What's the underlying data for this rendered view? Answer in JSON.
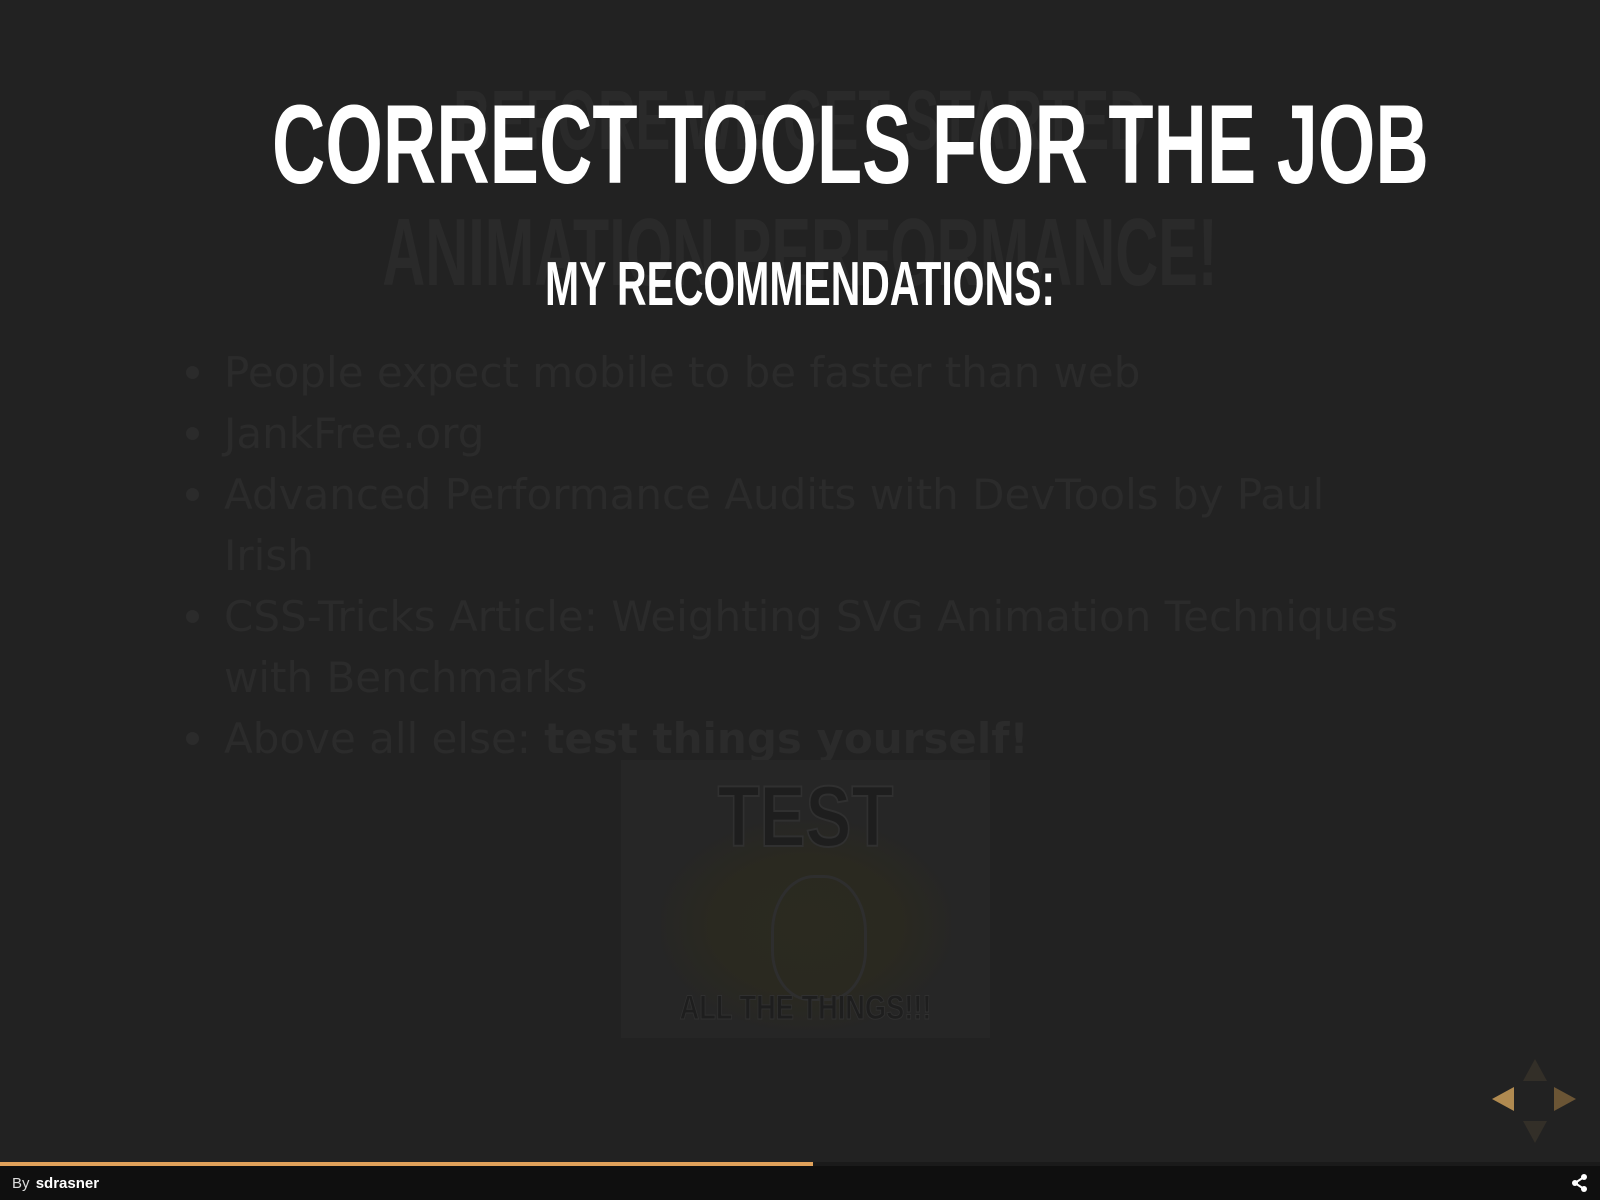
{
  "slide": {
    "title": "CORRECT TOOLS FOR THE JOB",
    "subtitle": "MY RECOMMENDATIONS:"
  },
  "background_slide": {
    "title_line1": "BEFORE WE GET STARTED",
    "title_line2": "ANIMATION PERFORMANCE!",
    "bullets": [
      "People expect mobile to be faster than web",
      "JankFree.org",
      "Advanced Performance Audits with DevTools by Paul Irish",
      "CSS-Tricks Article: Weighting SVG Animation Techniques with Benchmarks"
    ],
    "last_bullet_prefix": "Above all else: ",
    "last_bullet_emphasis": "test things yourself!",
    "meme_top_text": "TEST",
    "meme_bottom_text": "ALL THE THINGS!!!"
  },
  "progress": {
    "fraction": 0.508,
    "color": "#e0a15a"
  },
  "footer": {
    "by_label": "By",
    "author": "sdrasner"
  },
  "icons": {
    "share": "share-icon",
    "nav_left": "arrow-left-icon",
    "nav_right": "arrow-right-icon",
    "nav_up": "arrow-up-icon",
    "nav_down": "arrow-down-icon"
  }
}
